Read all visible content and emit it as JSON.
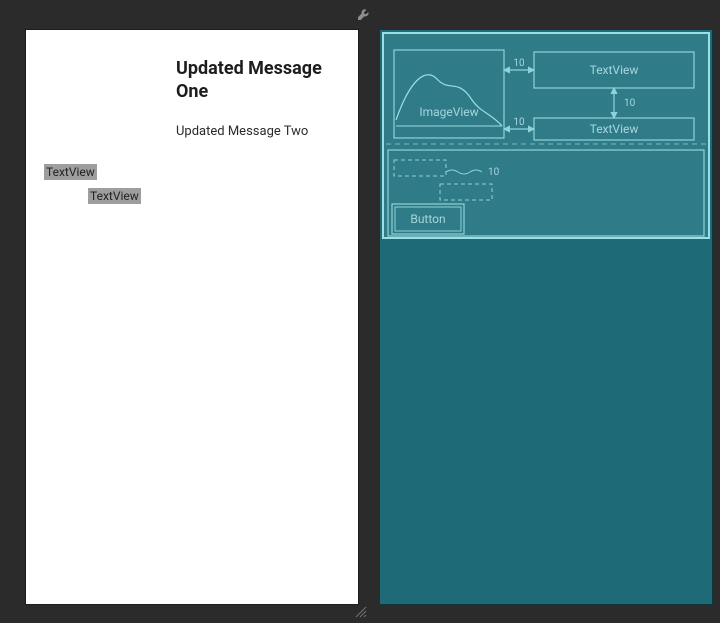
{
  "toolbar": {
    "wrench_icon": "wrench"
  },
  "design": {
    "heading": "Updated Message One",
    "subheading": "Updated Message Two",
    "placeholder1": "TextView",
    "placeholder2": "TextView"
  },
  "blueprint": {
    "imageview_label": "ImageView",
    "textview1_label": "TextView",
    "textview2_label": "TextView",
    "button_label": "Button",
    "margin_top_1": "10",
    "margin_top_2": "10",
    "margin_left_1": "10",
    "constraint_caption": "10"
  },
  "colors": {
    "canvas_bg": "#2b2b2b",
    "design_bg": "#ffffff",
    "blueprint_bg": "#1e6a77",
    "blueprint_line": "#8fd2d9",
    "blueprint_selection": "#9adfe6",
    "placeholder_bg": "#9e9e9e"
  }
}
